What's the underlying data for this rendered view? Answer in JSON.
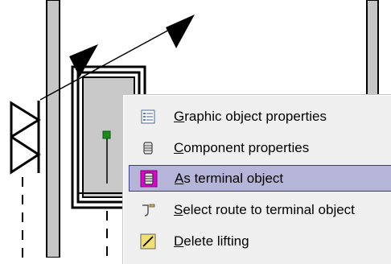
{
  "context_menu": {
    "items": [
      {
        "mnemonic": "G",
        "rest": "raphic object properties",
        "icon": "properties-list-icon",
        "selected": false
      },
      {
        "mnemonic": "C",
        "rest": "omponent properties",
        "icon": "component-stack-icon",
        "selected": false
      },
      {
        "mnemonic": "A",
        "rest": "s terminal object",
        "icon": "terminal-object-icon",
        "selected": true
      },
      {
        "mnemonic": "S",
        "rest": "elect route to terminal object",
        "icon": "route-hook-icon",
        "selected": false
      },
      {
        "mnemonic": "D",
        "rest": "elete lifting",
        "icon": "delete-lifting-icon",
        "selected": false
      }
    ]
  },
  "colors": {
    "highlight": "#b5b5d9",
    "highlight_border": "#3a3a8c",
    "node_green": "#1a8a1a",
    "icon_magenta": "#e000d0"
  }
}
